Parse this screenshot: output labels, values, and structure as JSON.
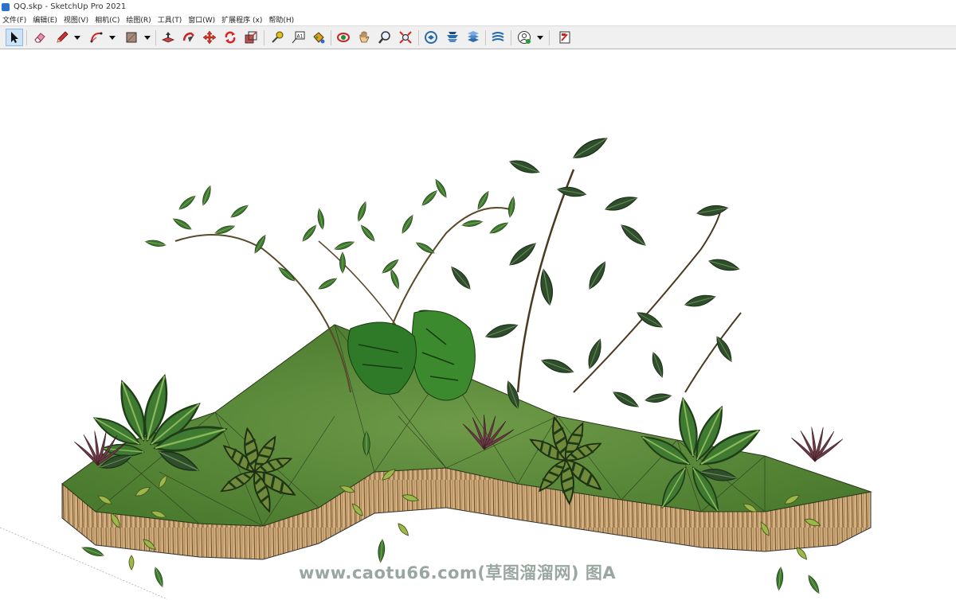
{
  "window": {
    "title": "QQ.skp - SketchUp Pro 2021"
  },
  "menu": {
    "items": [
      {
        "label": "文件(F)"
      },
      {
        "label": "编辑(E)"
      },
      {
        "label": "视图(V)"
      },
      {
        "label": "相机(C)"
      },
      {
        "label": "绘图(R)"
      },
      {
        "label": "工具(T)"
      },
      {
        "label": "窗口(W)"
      },
      {
        "label": "扩展程序 (x)"
      },
      {
        "label": "帮助(H)"
      }
    ]
  },
  "toolbar": {
    "tools": [
      "select-arrow-icon",
      "eraser-icon",
      "pencil-line-icon",
      "arc-icon",
      "rectangle-icon",
      "push-pull-icon",
      "follow-me-icon",
      "move-icon",
      "rotate-icon",
      "scale-icon",
      "tape-measure-icon",
      "text-label-icon",
      "paint-bucket-icon",
      "orbit-icon",
      "pan-hand-icon",
      "zoom-icon",
      "zoom-extents-icon",
      "3d-warehouse-icon",
      "extension-warehouse-icon",
      "layout-icon",
      "sandbox-icon",
      "account-icon",
      "send-to-layout-icon"
    ],
    "selected_tool": "select-arrow-icon"
  },
  "canvas": {
    "watermark": "www.caotu66.com(草图溜溜网) 图A",
    "colors": {
      "ground_grass": "#5f8f3a",
      "edge_bark": "#c9a57a",
      "leaf_dark": "#2f4f2c",
      "leaf_mid": "#3f7a32",
      "leaf_light": "#9cb84a",
      "grass_red": "#6d3a47"
    }
  }
}
